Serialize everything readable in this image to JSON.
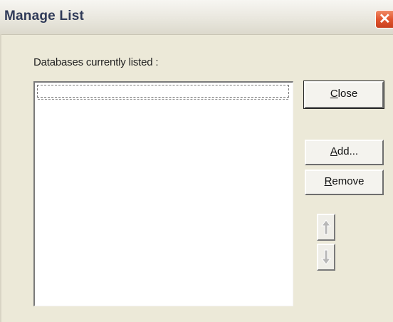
{
  "window": {
    "title": "Manage List"
  },
  "main": {
    "list_label": "Databases currently listed :",
    "list_items": []
  },
  "buttons": {
    "close": {
      "prefix": "",
      "mnemonic": "C",
      "rest": "lose"
    },
    "add": {
      "prefix": "",
      "mnemonic": "A",
      "rest": "dd..."
    },
    "remove": {
      "prefix": "",
      "mnemonic": "R",
      "rest": "emove"
    }
  },
  "icons": {
    "title_close": "close-icon",
    "move_up": "arrow-up-icon",
    "move_down": "arrow-down-icon"
  },
  "colors": {
    "dialog_bg": "#ece9d8",
    "title_close_red": "#e2562f",
    "disabled_gray": "#a0a0a0"
  }
}
